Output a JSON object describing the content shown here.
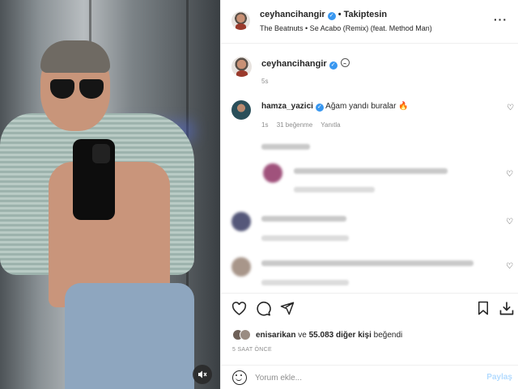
{
  "header": {
    "username": "ceyhancihangir",
    "separator": "•",
    "follow_status": "Takiptesin",
    "song": "The Beatnuts • Se Acabo (Remix) (feat. Method Man)",
    "more_icon": "more-horizontal-icon"
  },
  "caption": {
    "username": "ceyhancihangir",
    "emoji_icon": "sad-face-icon",
    "time": "5s"
  },
  "comments": [
    {
      "username": "hamza_yazici",
      "text": "Ağam yandı buralar 🔥",
      "time": "1s",
      "likes": "31 beğenme",
      "reply": "Yanıtla"
    }
  ],
  "actions": {
    "like_icon": "heart-icon",
    "comment_icon": "comment-icon",
    "share_icon": "send-icon",
    "save_icon": "bookmark-icon",
    "download_icon": "download-icon"
  },
  "likes": {
    "first_user": "enisarikan",
    "connector": "ve",
    "count": "55.083 diğer kişi",
    "suffix": "beğendi"
  },
  "posted_time": "5 SAAT ÖNCE",
  "comment_box": {
    "placeholder": "Yorum ekle...",
    "post_label": "Paylaş"
  },
  "media": {
    "mute_icon": "speaker-muted-icon"
  },
  "colors": {
    "verified": "#3897f0",
    "muted_text": "#8e8e8e",
    "post_button": "#b3dbff"
  }
}
